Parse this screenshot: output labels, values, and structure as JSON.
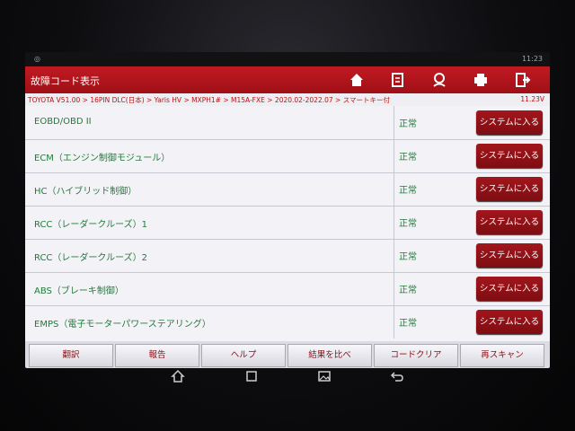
{
  "status_bar": {
    "left_icon": "notification-icon",
    "time": "11:23"
  },
  "header": {
    "title": "故障コード表示",
    "icons": [
      "home-icon",
      "report-edit-icon",
      "support-icon",
      "print-icon",
      "exit-icon"
    ]
  },
  "breadcrumb": {
    "path": "TOYOTA V51.00 > 16PIN DLC(日本) > Yaris HV > MXPH1# > M15A-FXE > 2020.02-2022.07 > スマートキー付",
    "voltage": "11.23V"
  },
  "systems": [
    {
      "name": "EOBD/OBD II",
      "status": "正常",
      "action": "システムに入る"
    },
    {
      "name": "ECM（エンジン制御モジュール）",
      "status": "正常",
      "action": "システムに入る"
    },
    {
      "name": "HC（ハイブリッド制御）",
      "status": "正常",
      "action": "システムに入る"
    },
    {
      "name": "RCC（レーダークルーズ）1",
      "status": "正常",
      "action": "システムに入る"
    },
    {
      "name": "RCC（レーダークルーズ）2",
      "status": "正常",
      "action": "システムに入る"
    },
    {
      "name": "ABS（ブレーキ制御）",
      "status": "正常",
      "action": "システムに入る"
    },
    {
      "name": "EMPS（電子モーターパワーステアリング）",
      "status": "正常",
      "action": "システムに入る"
    }
  ],
  "bottom_buttons": [
    "翻訳",
    "報告",
    "ヘルプ",
    "結果を比べ",
    "コードクリア",
    "再スキャン"
  ],
  "nav": [
    "home-icon",
    "recents-icon",
    "gallery-icon",
    "back-icon"
  ],
  "colors": {
    "accent": "#b0141b",
    "status_ok": "#247a3a",
    "list_bg": "#f2f2f7"
  }
}
